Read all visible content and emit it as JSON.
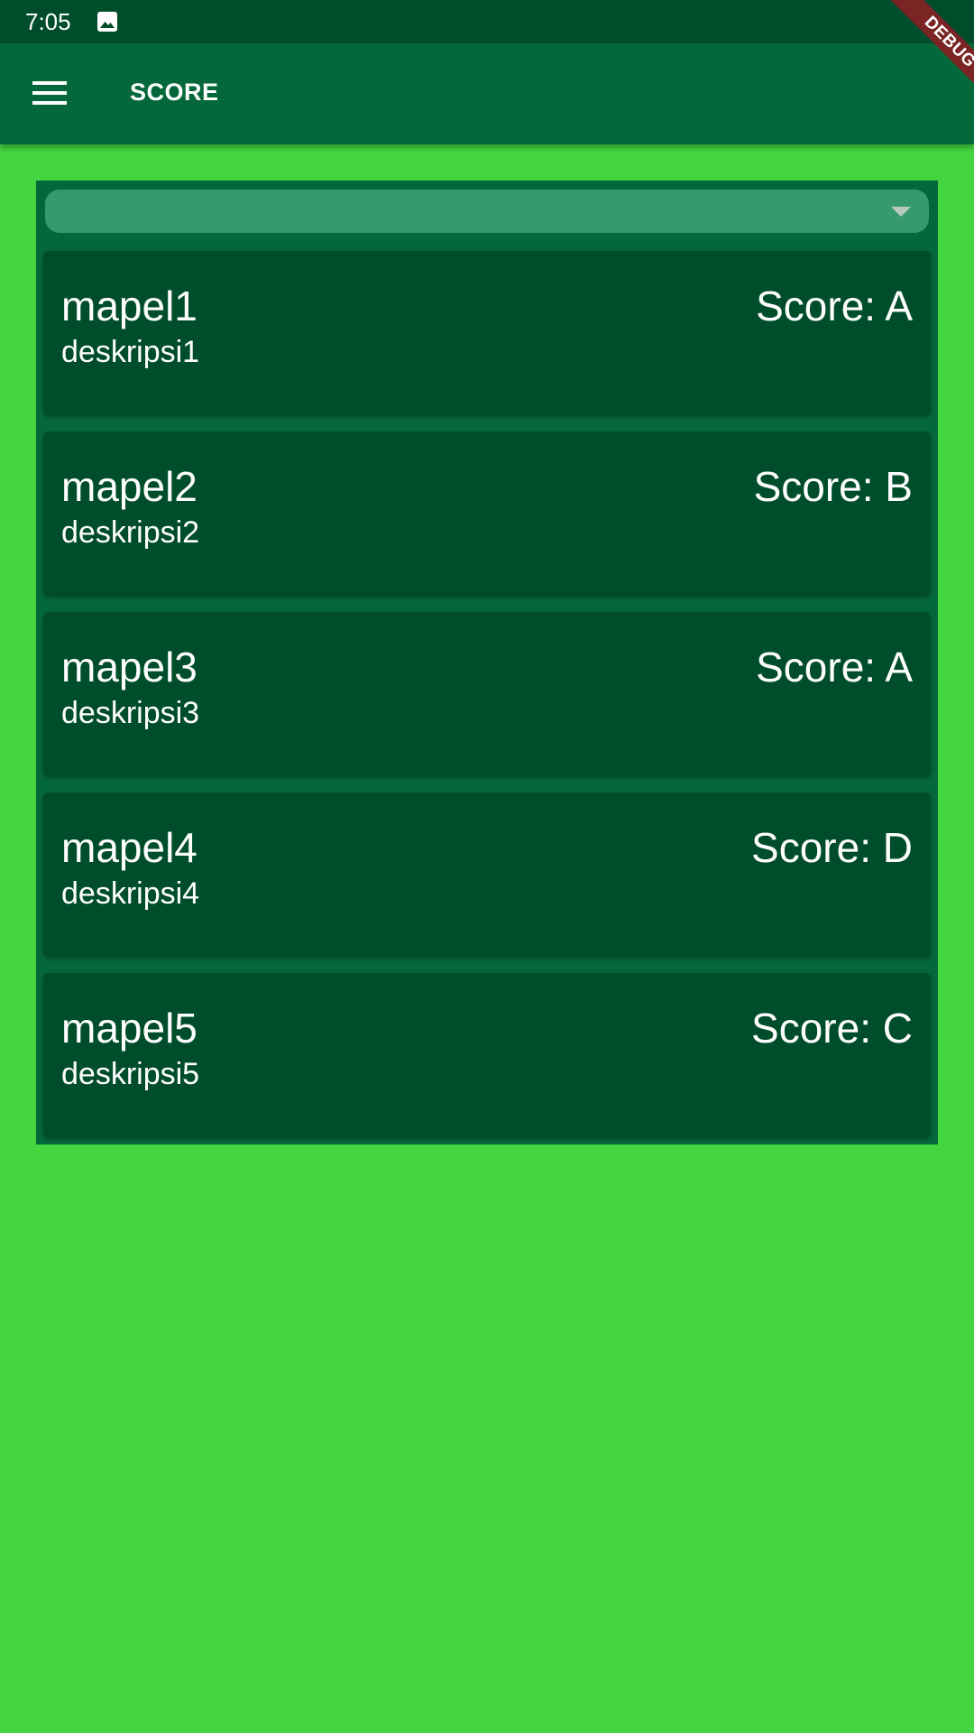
{
  "status_bar": {
    "time": "7:05",
    "notification_icon": "image-icon"
  },
  "app_bar": {
    "menu_icon": "hamburger-menu-icon",
    "title": "SCORE"
  },
  "debug_banner": {
    "label": "DEBUG"
  },
  "dropdown": {
    "selected_value": "",
    "icon": "dropdown-arrow-icon"
  },
  "scores": [
    {
      "subject": "mapel1",
      "description": "deskripsi1",
      "score": "Score: A"
    },
    {
      "subject": "mapel2",
      "description": "deskripsi2",
      "score": "Score: B"
    },
    {
      "subject": "mapel3",
      "description": "deskripsi3",
      "score": "Score: A"
    },
    {
      "subject": "mapel4",
      "description": "deskripsi4",
      "score": "Score: D"
    },
    {
      "subject": "mapel5",
      "description": "deskripsi5",
      "score": "Score: C"
    }
  ],
  "colors": {
    "background": "#44d541",
    "status_bar": "#004d2c",
    "app_bar": "#05683a",
    "panel": "#05683a",
    "dropdown": "#379a6c",
    "card": "#004d2c",
    "debug_ribbon": "#7a2424",
    "text": "#ffffff"
  }
}
